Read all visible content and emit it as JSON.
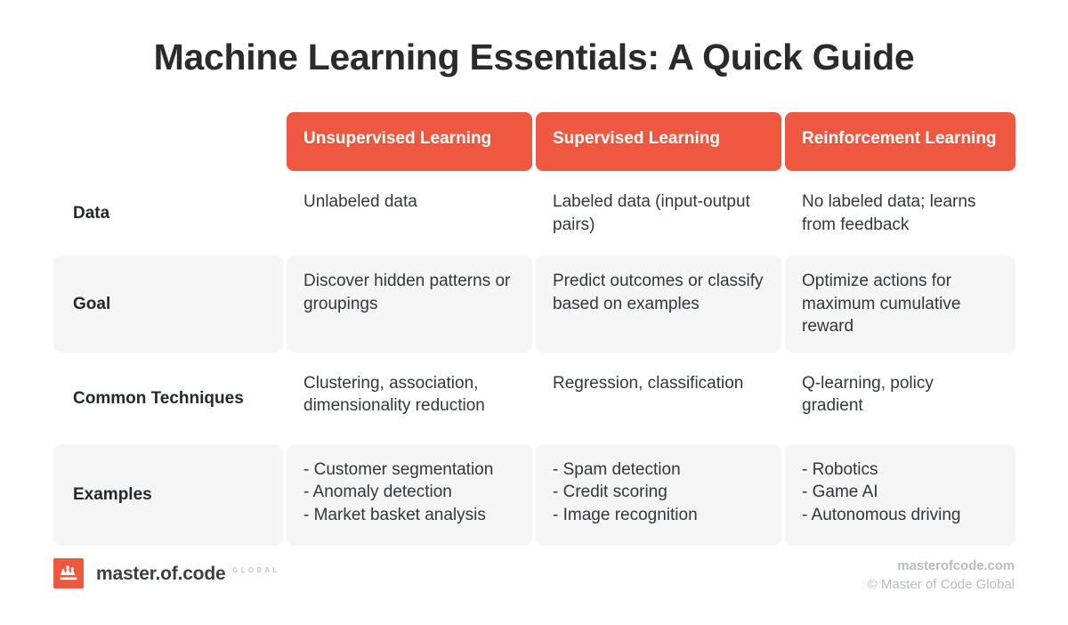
{
  "title": "Machine Learning Essentials: A Quick Guide",
  "colors": {
    "header_background": "#ef5840",
    "header_text": "#ffffff",
    "shaded_row_background": "#f5f5f5",
    "body_text": "#33373a",
    "title_text": "#2b2b2b",
    "footer_text": "#b8bcbf"
  },
  "table": {
    "corner_label": "",
    "columns": [
      {
        "label": "Unsupervised Learning"
      },
      {
        "label": "Supervised Learning"
      },
      {
        "label": "Reinforcement Learning"
      }
    ],
    "rows": [
      {
        "label": "Data",
        "shaded": false,
        "cells": [
          "Unlabeled data",
          "Labeled data (input-output pairs)",
          "No labeled data; learns from feedback"
        ]
      },
      {
        "label": "Goal",
        "shaded": true,
        "cells": [
          "Discover hidden patterns or groupings",
          "Predict outcomes or classify based on examples",
          "Optimize actions for maximum cumulative reward"
        ]
      },
      {
        "label": "Common Techniques",
        "shaded": false,
        "cells": [
          "Clustering, association, dimensionality reduction",
          "Regression, classification",
          "Q-learning, policy gradient"
        ]
      },
      {
        "label": "Examples",
        "shaded": true,
        "cells": [
          "- Customer segmentation\n- Anomaly detection\n- Market basket analysis",
          "- Spam detection\n- Credit scoring\n- Image recognition",
          "- Robotics\n- Game AI\n- Autonomous driving"
        ]
      }
    ]
  },
  "footer": {
    "logo_word": "master.of.code",
    "logo_global": "GLOBAL",
    "site": "masterofcode.com",
    "copyright": "© Master of Code Global"
  }
}
